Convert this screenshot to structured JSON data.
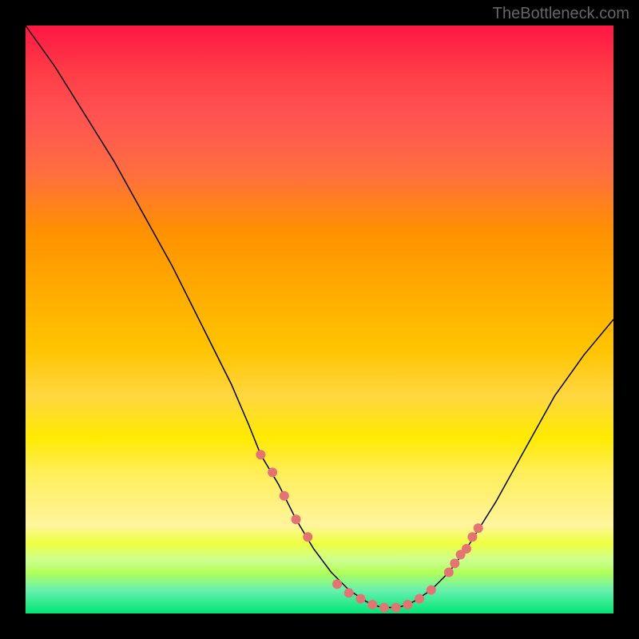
{
  "attribution": "TheBottleneck.com",
  "chart_data": {
    "type": "line",
    "title": "",
    "xlabel": "",
    "ylabel": "",
    "xlim": [
      0,
      100
    ],
    "ylim": [
      0,
      100
    ],
    "curve": [
      {
        "x": 0,
        "y": 100
      },
      {
        "x": 5,
        "y": 93
      },
      {
        "x": 10,
        "y": 85
      },
      {
        "x": 15,
        "y": 77
      },
      {
        "x": 20,
        "y": 68
      },
      {
        "x": 25,
        "y": 59
      },
      {
        "x": 30,
        "y": 49
      },
      {
        "x": 35,
        "y": 39
      },
      {
        "x": 38,
        "y": 32
      },
      {
        "x": 40,
        "y": 27
      },
      {
        "x": 43,
        "y": 22
      },
      {
        "x": 46,
        "y": 16
      },
      {
        "x": 49,
        "y": 11
      },
      {
        "x": 52,
        "y": 7
      },
      {
        "x": 55,
        "y": 4
      },
      {
        "x": 58,
        "y": 2
      },
      {
        "x": 60,
        "y": 1.2
      },
      {
        "x": 62,
        "y": 1
      },
      {
        "x": 64,
        "y": 1.2
      },
      {
        "x": 66,
        "y": 2
      },
      {
        "x": 69,
        "y": 4
      },
      {
        "x": 72,
        "y": 7
      },
      {
        "x": 75,
        "y": 11
      },
      {
        "x": 80,
        "y": 19
      },
      {
        "x": 85,
        "y": 28
      },
      {
        "x": 90,
        "y": 37
      },
      {
        "x": 95,
        "y": 44
      },
      {
        "x": 100,
        "y": 50
      }
    ],
    "markers": [
      {
        "x": 40,
        "y": 27
      },
      {
        "x": 42,
        "y": 24
      },
      {
        "x": 44,
        "y": 20
      },
      {
        "x": 46,
        "y": 16
      },
      {
        "x": 48,
        "y": 13
      },
      {
        "x": 53,
        "y": 5
      },
      {
        "x": 55,
        "y": 3.5
      },
      {
        "x": 57,
        "y": 2.5
      },
      {
        "x": 59,
        "y": 1.5
      },
      {
        "x": 61,
        "y": 1
      },
      {
        "x": 63,
        "y": 1
      },
      {
        "x": 65,
        "y": 1.5
      },
      {
        "x": 67,
        "y": 2.5
      },
      {
        "x": 69,
        "y": 4
      },
      {
        "x": 72,
        "y": 7
      },
      {
        "x": 73,
        "y": 8.5
      },
      {
        "x": 74,
        "y": 10
      },
      {
        "x": 75,
        "y": 11
      },
      {
        "x": 76,
        "y": 13
      },
      {
        "x": 77,
        "y": 14.5
      }
    ],
    "colors": {
      "curve": "#000000",
      "marker": "#e57373",
      "gradient_top": "#ff1744",
      "gradient_bottom": "#00e676"
    }
  }
}
